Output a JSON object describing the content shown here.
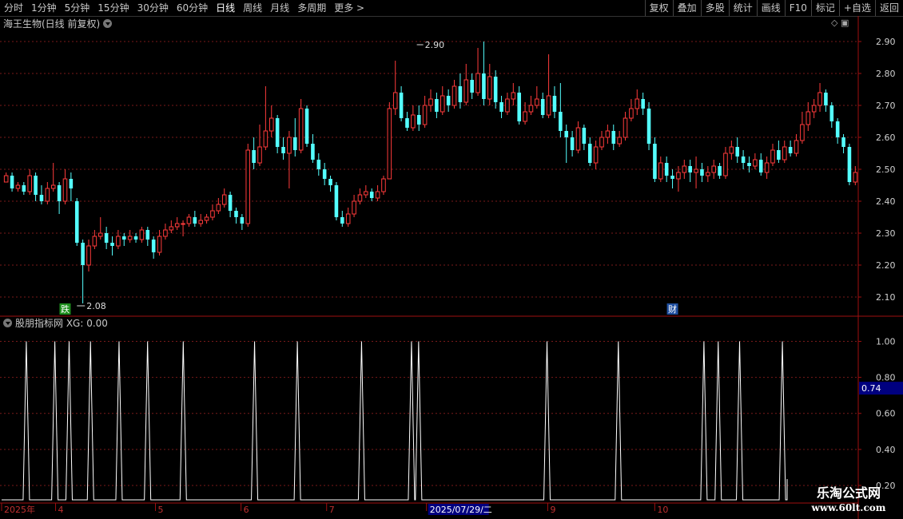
{
  "toolbar": {
    "left": [
      "分时",
      "1分钟",
      "5分钟",
      "15分钟",
      "30分钟",
      "60分钟",
      "日线",
      "周线",
      "月线",
      "多周期",
      "更多 >"
    ],
    "active_index": 6,
    "right": [
      "复权",
      "叠加",
      "多股",
      "统计",
      "画线",
      "F10",
      "标记",
      "+自选",
      "返回"
    ]
  },
  "main_title": "海王生物(日线 前复权)",
  "indicator_title": "股朋指标网 XG: 0.00",
  "watermark": {
    "line1": "乐淘公式网",
    "line2": "www.60lt.com"
  },
  "colors": {
    "up": "#ff3b3b",
    "down": "#54ffff",
    "grid": "#7a1a1a",
    "axis": "#a01010",
    "line": "#ffffff",
    "highlight_box": "#000080"
  },
  "chart_data": [
    {
      "type": "candlestick",
      "title": "海王生物(日线 前复权)",
      "ylim": [
        2.05,
        2.93
      ],
      "y_ticks": [
        "2.10",
        "2.20",
        "2.30",
        "2.40",
        "2.50",
        "2.60",
        "2.70",
        "2.80",
        "2.90"
      ],
      "annotations": {
        "high_label": "2.90",
        "high_index": 71,
        "low_label": "2.08",
        "low_index": 12,
        "markers": [
          {
            "text": "跌",
            "index": 10,
            "color": "#1e8f1e"
          },
          {
            "text": "财",
            "index": 113,
            "color": "#1f4fa0"
          }
        ]
      },
      "candles": [
        [
          2.46,
          2.48,
          2.49,
          2.46
        ],
        [
          2.48,
          2.44,
          2.49,
          2.43
        ],
        [
          2.44,
          2.45,
          2.46,
          2.43
        ],
        [
          2.45,
          2.43,
          2.46,
          2.42
        ],
        [
          2.43,
          2.48,
          2.5,
          2.42
        ],
        [
          2.48,
          2.42,
          2.49,
          2.4
        ],
        [
          2.42,
          2.4,
          2.45,
          2.39
        ],
        [
          2.4,
          2.44,
          2.46,
          2.39
        ],
        [
          2.44,
          2.45,
          2.52,
          2.43
        ],
        [
          2.45,
          2.4,
          2.46,
          2.36
        ],
        [
          2.4,
          2.47,
          2.5,
          2.39
        ],
        [
          2.47,
          2.44,
          2.49,
          2.4
        ],
        [
          2.4,
          2.27,
          2.41,
          2.26
        ],
        [
          2.27,
          2.2,
          2.28,
          2.08
        ],
        [
          2.2,
          2.26,
          2.28,
          2.18
        ],
        [
          2.26,
          2.29,
          2.31,
          2.25
        ],
        [
          2.29,
          2.3,
          2.35,
          2.28
        ],
        [
          2.3,
          2.27,
          2.32,
          2.25
        ],
        [
          2.27,
          2.26,
          2.29,
          2.23
        ],
        [
          2.26,
          2.29,
          2.31,
          2.25
        ],
        [
          2.29,
          2.28,
          2.3,
          2.26
        ],
        [
          2.28,
          2.29,
          2.31,
          2.27
        ],
        [
          2.29,
          2.28,
          2.3,
          2.27
        ],
        [
          2.28,
          2.31,
          2.32,
          2.27
        ],
        [
          2.31,
          2.28,
          2.32,
          2.26
        ],
        [
          2.28,
          2.24,
          2.29,
          2.22
        ],
        [
          2.24,
          2.29,
          2.31,
          2.23
        ],
        [
          2.29,
          2.31,
          2.33,
          2.28
        ],
        [
          2.31,
          2.32,
          2.34,
          2.3
        ],
        [
          2.32,
          2.33,
          2.35,
          2.31
        ],
        [
          2.33,
          2.33,
          2.34,
          2.29
        ],
        [
          2.33,
          2.35,
          2.36,
          2.32
        ],
        [
          2.35,
          2.33,
          2.37,
          2.32
        ],
        [
          2.33,
          2.34,
          2.36,
          2.32
        ],
        [
          2.34,
          2.35,
          2.36,
          2.33
        ],
        [
          2.35,
          2.37,
          2.39,
          2.34
        ],
        [
          2.37,
          2.39,
          2.41,
          2.36
        ],
        [
          2.39,
          2.42,
          2.44,
          2.38
        ],
        [
          2.42,
          2.37,
          2.43,
          2.35
        ],
        [
          2.37,
          2.35,
          2.38,
          2.33
        ],
        [
          2.35,
          2.33,
          2.36,
          2.31
        ],
        [
          2.33,
          2.56,
          2.58,
          2.32
        ],
        [
          2.56,
          2.52,
          2.6,
          2.5
        ],
        [
          2.52,
          2.57,
          2.64,
          2.51
        ],
        [
          2.57,
          2.62,
          2.76,
          2.56
        ],
        [
          2.62,
          2.66,
          2.7,
          2.6
        ],
        [
          2.66,
          2.57,
          2.67,
          2.55
        ],
        [
          2.57,
          2.55,
          2.6,
          2.53
        ],
        [
          2.55,
          2.6,
          2.62,
          2.44
        ],
        [
          2.6,
          2.56,
          2.66,
          2.54
        ],
        [
          2.56,
          2.69,
          2.72,
          2.55
        ],
        [
          2.69,
          2.58,
          2.7,
          2.57
        ],
        [
          2.58,
          2.53,
          2.61,
          2.52
        ],
        [
          2.53,
          2.5,
          2.55,
          2.48
        ],
        [
          2.5,
          2.47,
          2.52,
          2.45
        ],
        [
          2.47,
          2.45,
          2.48,
          2.43
        ],
        [
          2.45,
          2.35,
          2.46,
          2.34
        ],
        [
          2.35,
          2.33,
          2.37,
          2.32
        ],
        [
          2.33,
          2.36,
          2.38,
          2.32
        ],
        [
          2.36,
          2.4,
          2.42,
          2.35
        ],
        [
          2.4,
          2.42,
          2.44,
          2.39
        ],
        [
          2.42,
          2.43,
          2.45,
          2.41
        ],
        [
          2.43,
          2.41,
          2.44,
          2.4
        ],
        [
          2.41,
          2.43,
          2.45,
          2.4
        ],
        [
          2.43,
          2.47,
          2.48,
          2.42
        ],
        [
          2.47,
          2.69,
          2.71,
          2.57
        ],
        [
          2.69,
          2.74,
          2.84,
          2.67
        ],
        [
          2.74,
          2.66,
          2.76,
          2.65
        ],
        [
          2.66,
          2.63,
          2.68,
          2.62
        ],
        [
          2.63,
          2.67,
          2.7,
          2.62
        ],
        [
          2.67,
          2.64,
          2.7,
          2.62
        ],
        [
          2.64,
          2.7,
          2.73,
          2.63
        ],
        [
          2.7,
          2.72,
          2.75,
          2.68
        ],
        [
          2.72,
          2.68,
          2.74,
          2.66
        ],
        [
          2.68,
          2.73,
          2.76,
          2.67
        ],
        [
          2.73,
          2.7,
          2.75,
          2.68
        ],
        [
          2.7,
          2.76,
          2.78,
          2.69
        ],
        [
          2.76,
          2.71,
          2.8,
          2.69
        ],
        [
          2.71,
          2.78,
          2.83,
          2.7
        ],
        [
          2.78,
          2.74,
          2.8,
          2.72
        ],
        [
          2.74,
          2.8,
          2.88,
          2.73
        ],
        [
          2.8,
          2.72,
          2.9,
          2.7
        ],
        [
          2.72,
          2.79,
          2.83,
          2.7
        ],
        [
          2.79,
          2.71,
          2.81,
          2.69
        ],
        [
          2.71,
          2.68,
          2.73,
          2.66
        ],
        [
          2.68,
          2.72,
          2.74,
          2.67
        ],
        [
          2.72,
          2.74,
          2.77,
          2.7
        ],
        [
          2.74,
          2.65,
          2.76,
          2.64
        ],
        [
          2.65,
          2.68,
          2.71,
          2.64
        ],
        [
          2.68,
          2.7,
          2.73,
          2.67
        ],
        [
          2.7,
          2.72,
          2.76,
          2.69
        ],
        [
          2.72,
          2.67,
          2.74,
          2.66
        ],
        [
          2.67,
          2.73,
          2.86,
          2.66
        ],
        [
          2.73,
          2.68,
          2.76,
          2.66
        ],
        [
          2.68,
          2.62,
          2.77,
          2.6
        ],
        [
          2.62,
          2.6,
          2.64,
          2.52
        ],
        [
          2.6,
          2.56,
          2.62,
          2.54
        ],
        [
          2.56,
          2.63,
          2.65,
          2.55
        ],
        [
          2.63,
          2.58,
          2.64,
          2.56
        ],
        [
          2.58,
          2.52,
          2.6,
          2.51
        ],
        [
          2.52,
          2.57,
          2.59,
          2.5
        ],
        [
          2.57,
          2.6,
          2.62,
          2.56
        ],
        [
          2.6,
          2.62,
          2.64,
          2.58
        ],
        [
          2.62,
          2.58,
          2.64,
          2.56
        ],
        [
          2.58,
          2.6,
          2.62,
          2.57
        ],
        [
          2.6,
          2.66,
          2.68,
          2.59
        ],
        [
          2.66,
          2.69,
          2.72,
          2.65
        ],
        [
          2.69,
          2.72,
          2.75,
          2.67
        ],
        [
          2.72,
          2.69,
          2.74,
          2.67
        ],
        [
          2.69,
          2.58,
          2.71,
          2.56
        ],
        [
          2.58,
          2.47,
          2.6,
          2.46
        ],
        [
          2.47,
          2.52,
          2.54,
          2.46
        ],
        [
          2.52,
          2.48,
          2.54,
          2.46
        ],
        [
          2.48,
          2.47,
          2.5,
          2.44
        ],
        [
          2.47,
          2.49,
          2.51,
          2.43
        ],
        [
          2.49,
          2.51,
          2.53,
          2.47
        ],
        [
          2.51,
          2.49,
          2.53,
          2.46
        ],
        [
          2.49,
          2.5,
          2.54,
          2.44
        ],
        [
          2.5,
          2.48,
          2.52,
          2.46
        ],
        [
          2.48,
          2.49,
          2.51,
          2.46
        ],
        [
          2.49,
          2.51,
          2.53,
          2.47
        ],
        [
          2.51,
          2.48,
          2.52,
          2.47
        ],
        [
          2.48,
          2.55,
          2.57,
          2.47
        ],
        [
          2.55,
          2.57,
          2.59,
          2.53
        ],
        [
          2.57,
          2.54,
          2.6,
          2.52
        ],
        [
          2.54,
          2.52,
          2.56,
          2.5
        ],
        [
          2.52,
          2.51,
          2.54,
          2.49
        ],
        [
          2.51,
          2.53,
          2.55,
          2.5
        ],
        [
          2.53,
          2.49,
          2.55,
          2.48
        ],
        [
          2.49,
          2.52,
          2.54,
          2.47
        ],
        [
          2.52,
          2.56,
          2.58,
          2.51
        ],
        [
          2.56,
          2.53,
          2.59,
          2.52
        ],
        [
          2.53,
          2.57,
          2.59,
          2.52
        ],
        [
          2.57,
          2.55,
          2.59,
          2.54
        ],
        [
          2.55,
          2.59,
          2.61,
          2.54
        ],
        [
          2.59,
          2.64,
          2.68,
          2.58
        ],
        [
          2.64,
          2.68,
          2.71,
          2.62
        ],
        [
          2.68,
          2.7,
          2.72,
          2.66
        ],
        [
          2.7,
          2.74,
          2.77,
          2.68
        ],
        [
          2.74,
          2.7,
          2.75,
          2.68
        ],
        [
          2.7,
          2.65,
          2.71,
          2.63
        ],
        [
          2.65,
          2.6,
          2.66,
          2.58
        ],
        [
          2.6,
          2.57,
          2.61,
          2.55
        ],
        [
          2.57,
          2.46,
          2.58,
          2.45
        ],
        [
          2.46,
          2.49,
          2.51,
          2.45
        ]
      ]
    },
    {
      "type": "line",
      "title": "股朋指标网 XG: 0.00",
      "ylim": [
        0.12,
        1.06
      ],
      "y_ticks": [
        "0.20",
        "0.40",
        "0.60",
        "0.80",
        "1.00"
      ],
      "highlight_value_label": "0.74",
      "highlight_value": 0.74,
      "spike_indices": [
        1,
        5,
        7,
        10,
        14,
        18,
        23,
        33,
        39,
        48,
        55,
        56,
        74,
        84,
        96,
        98,
        101,
        107
      ],
      "x_labels": [
        "2025年",
        "4",
        "5",
        "6",
        "7",
        "2025/07/29/二",
        "9",
        "10"
      ],
      "x_label_indices": [
        0,
        6,
        20,
        32,
        44,
        58,
        75,
        90
      ]
    }
  ]
}
